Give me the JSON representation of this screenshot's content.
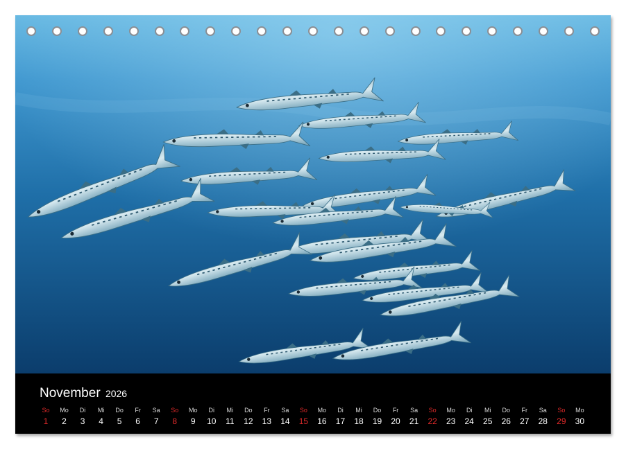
{
  "calendar": {
    "month": "November",
    "year": "2026",
    "days": [
      {
        "name": "So",
        "num": "1",
        "sunday": true
      },
      {
        "name": "Mo",
        "num": "2"
      },
      {
        "name": "Di",
        "num": "3"
      },
      {
        "name": "Mi",
        "num": "4"
      },
      {
        "name": "Do",
        "num": "5"
      },
      {
        "name": "Fr",
        "num": "6"
      },
      {
        "name": "Sa",
        "num": "7"
      },
      {
        "name": "So",
        "num": "8",
        "sunday": true
      },
      {
        "name": "Mo",
        "num": "9"
      },
      {
        "name": "Di",
        "num": "10"
      },
      {
        "name": "Mi",
        "num": "11"
      },
      {
        "name": "Do",
        "num": "12"
      },
      {
        "name": "Fr",
        "num": "13"
      },
      {
        "name": "Sa",
        "num": "14"
      },
      {
        "name": "So",
        "num": "15",
        "sunday": true
      },
      {
        "name": "Mo",
        "num": "16"
      },
      {
        "name": "Di",
        "num": "17"
      },
      {
        "name": "Mi",
        "num": "18"
      },
      {
        "name": "Do",
        "num": "19"
      },
      {
        "name": "Fr",
        "num": "20"
      },
      {
        "name": "Sa",
        "num": "21"
      },
      {
        "name": "So",
        "num": "22",
        "sunday": true
      },
      {
        "name": "Mo",
        "num": "23"
      },
      {
        "name": "Di",
        "num": "24"
      },
      {
        "name": "Mi",
        "num": "25"
      },
      {
        "name": "Do",
        "num": "26"
      },
      {
        "name": "Fr",
        "num": "27"
      },
      {
        "name": "Sa",
        "num": "28"
      },
      {
        "name": "So",
        "num": "29",
        "sunday": true
      },
      {
        "name": "Mo",
        "num": "30"
      }
    ],
    "sunday_color": "#e02a2a"
  },
  "photo": {
    "subject": "barracuda-school",
    "water_color": "#1f6fa8"
  },
  "binding_holes": 23
}
